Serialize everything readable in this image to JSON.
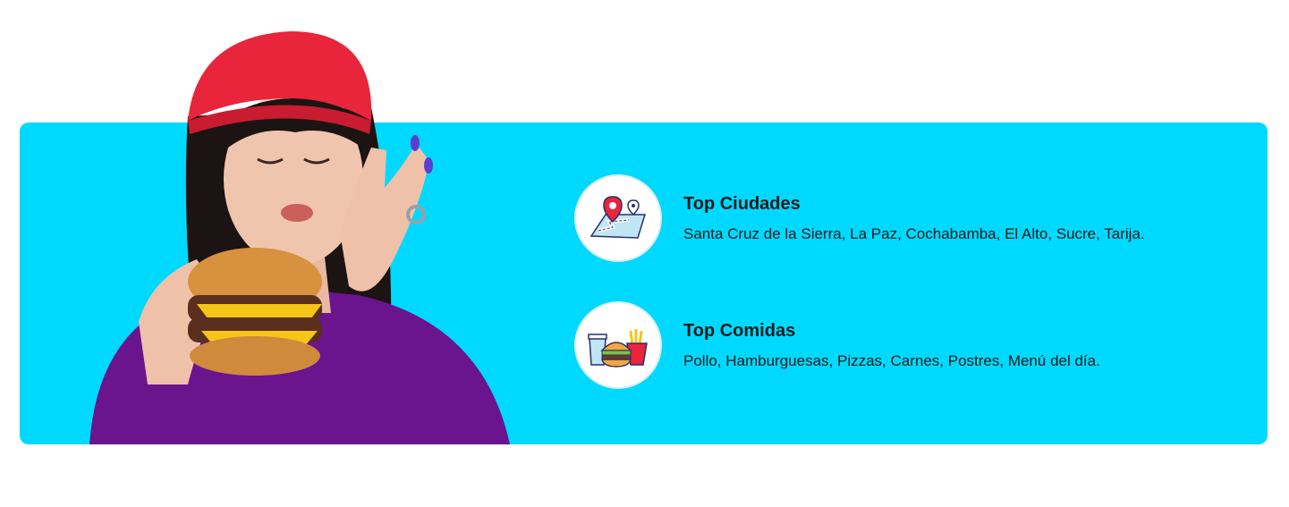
{
  "highlights": [
    {
      "icon": "map-pin-icon",
      "title": "Top Ciudades",
      "description": "Santa Cruz de la Sierra, La Paz, Cochabamba, El Alto, Sucre, Tarija."
    },
    {
      "icon": "fast-food-icon",
      "title": "Top Comidas",
      "description": "Pollo, Hamburguesas, Pizzas, Carnes, Postres, Menú del día."
    }
  ],
  "colors": {
    "banner": "#00d9ff",
    "beanie": "#e8253b",
    "sweater": "#6a148e",
    "text": "#1a1a1a"
  }
}
